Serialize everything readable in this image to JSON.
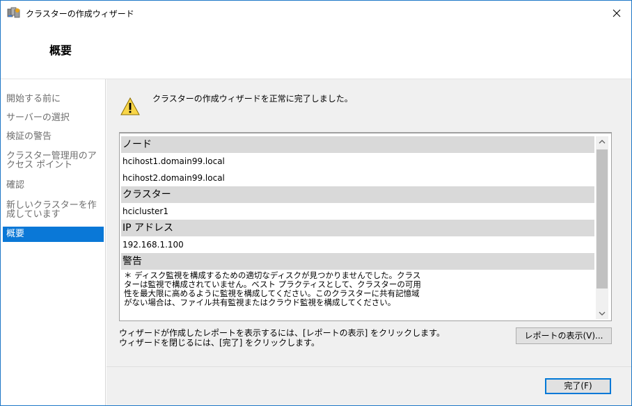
{
  "window": {
    "title": "クラスターの作成ウィザード",
    "app_icon": "cluster-wizard-icon",
    "close_icon": "close-icon"
  },
  "header": {
    "title": "概要"
  },
  "sidebar": {
    "items": [
      {
        "label": "開始する前に",
        "active": false
      },
      {
        "label": "サーバーの選択",
        "active": false
      },
      {
        "label": "検証の警告",
        "active": false
      },
      {
        "label": "クラスター管理用のアクセス ポイント",
        "active": false
      },
      {
        "label": "確認",
        "active": false
      },
      {
        "label": "新しいクラスターを作成しています",
        "active": false
      },
      {
        "label": "概要",
        "active": true
      }
    ]
  },
  "main": {
    "status_icon": "warning-icon",
    "status_text": "クラスターの作成ウィザードを正常に完了しました。",
    "report": {
      "sections": [
        {
          "header": "ノード",
          "rows": [
            "hcihost1.domain99.local",
            "hcihost2.domain99.local"
          ]
        },
        {
          "header": "クラスター",
          "rows": [
            "hcicluster1"
          ]
        },
        {
          "header": "IP アドレス",
          "rows": [
            "192.168.1.100"
          ]
        },
        {
          "header": "警告",
          "text": "＊ ディスク監視を構成するための適切なディスクが見つかりませんでした。クラスターは監視で構成されていません。ベスト プラクティスとして、クラスターの可用性を最大限に高めるように監視を構成してください。このクラスターに共有記憶域がない場合は、ファイル共有監視またはクラウド監視を構成してください。"
        }
      ]
    },
    "info_line1": "ウィザードが作成したレポートを表示するには、[レポートの表示] をクリックします。",
    "info_line2": "ウィザードを閉じるには、[完了] をクリックします。",
    "view_report_button": "レポートの表示(V)...",
    "finish_button": "完了(F)"
  },
  "colors": {
    "accent": "#0a78d7",
    "section_header_bg": "#d9d9d9",
    "panel_bg": "#f0f0f0"
  }
}
